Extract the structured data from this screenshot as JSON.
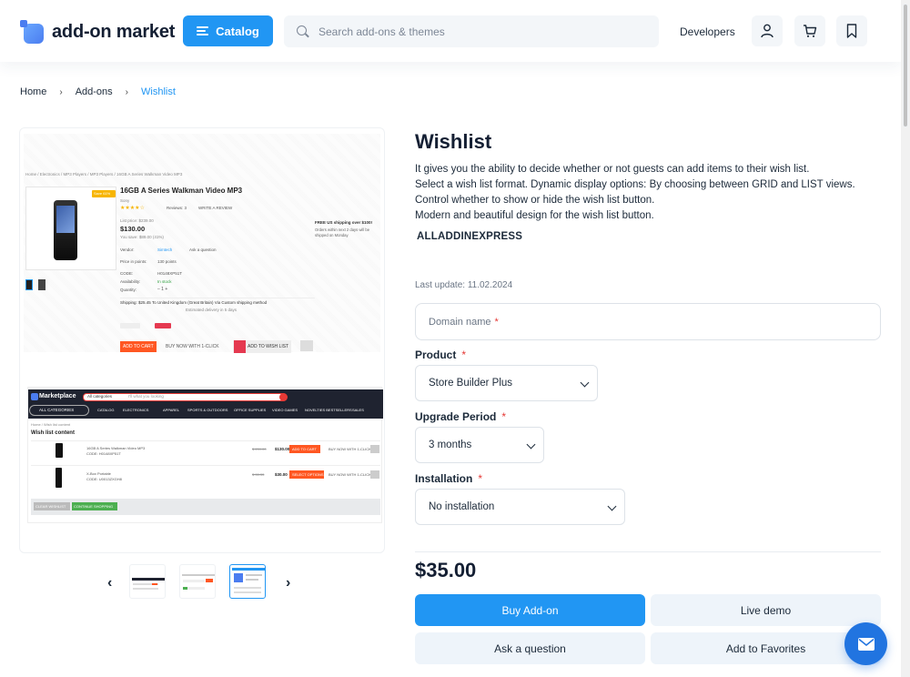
{
  "header": {
    "logo_text": "add-on market",
    "catalog_label": "Catalog",
    "search_placeholder": "Search add-ons & themes",
    "developers_label": "Developers",
    "icons": [
      "account-icon",
      "cart-icon",
      "bookmark-icon"
    ]
  },
  "breadcrumb": {
    "items": [
      "Home",
      "Add-ons"
    ],
    "current": "Wishlist"
  },
  "product": {
    "title": "Wishlist",
    "description": [
      "It gives you the ability to decide whether or not guests can add items to their wish list.",
      "Select a wish list format. Dynamic display options: By choosing between GRID and LIST views.",
      "Control whether to show or hide the wish list button.",
      "Modern and beautiful design for the wish list button."
    ],
    "vendor": "ALLADDINEXPRESS",
    "last_update": "Last update: 11.02.2024",
    "price": "$35.00"
  },
  "form": {
    "domain_placeholder": "Domain name",
    "required_mark": "*",
    "product_label": "Product",
    "product_value": "Store Builder Plus",
    "upgrade_label": "Upgrade Period",
    "upgrade_value": "3 months",
    "installation_label": "Installation",
    "installation_value": "No installation"
  },
  "actions": {
    "buy": "Buy Add-on",
    "demo": "Live demo",
    "ask": "Ask a question",
    "favorites": "Add to Favorites"
  },
  "screenshot": {
    "crumbs": "Home / Electronics / MP3 Players / MP3 Players / 16GB A Series Walkman Video MP3",
    "sale": "Save 61%",
    "product_name": "16GB A Series Walkman Video MP3",
    "brand": "Sony",
    "reviews": "Reviews: 3",
    "write_review": "WRITE A REVIEW",
    "list_price": "List price: $239.00",
    "price": "$130.00",
    "save": "You save: $89.00 (41%)",
    "vendor_label": "Vendor:",
    "vendor_value": "Simtech",
    "ask": "Ask a question",
    "points_label": "Price in points:",
    "points_value": "130 points",
    "code_label": "CODE:",
    "code_value": "H0148XP51T",
    "avail_label": "Availability:",
    "avail_value": "In stock",
    "qty_label": "Quantity:",
    "free_ship": "FREE US shipping over $100!",
    "free_ship_note": "Orders within next 2 days will be shipped on Monday",
    "shipping": "Shipping: $25.45 To United Kingdom (Great Britain) Via Custom shipping method",
    "estimated": "Estimated delivery in 5 days",
    "add_to_cart": "ADD TO CART",
    "buy_now": "BUY NOW WITH 1-CLICK",
    "add_wish": "ADD TO WISH LIST",
    "market_logo": "Marketplace",
    "all_categories": "All categories",
    "search_hint": "I'll what you looking",
    "nav_all": "ALL CATEGORIES",
    "nav_items": [
      "CATALOG",
      "ELECTRONICS",
      "APPAREL",
      "SPORTS & OUTDOORS",
      "OFFICE SUPPLIES",
      "VIDEO GAMES",
      "NOVELTIES BESTSELLERS",
      "SALES"
    ],
    "wl_crumbs": "Home / Wish list content",
    "wl_title": "Wish list content",
    "wl_items": [
      {
        "name": "16GB A Series Walkman Video MP3",
        "code": "CODE: H0148XP51T",
        "old": "$ 239.00",
        "price": "$130.00",
        "btn": "ADD TO CART"
      },
      {
        "name": "X-Box Portable",
        "code": "CODE: U0013ZXGH8",
        "old": "$ 33.33",
        "price": "$30.00",
        "btn": "SELECT OPTIONS"
      }
    ],
    "clear": "CLEAR WISHLIST",
    "continue": "CONTINUE SHOPPING"
  }
}
